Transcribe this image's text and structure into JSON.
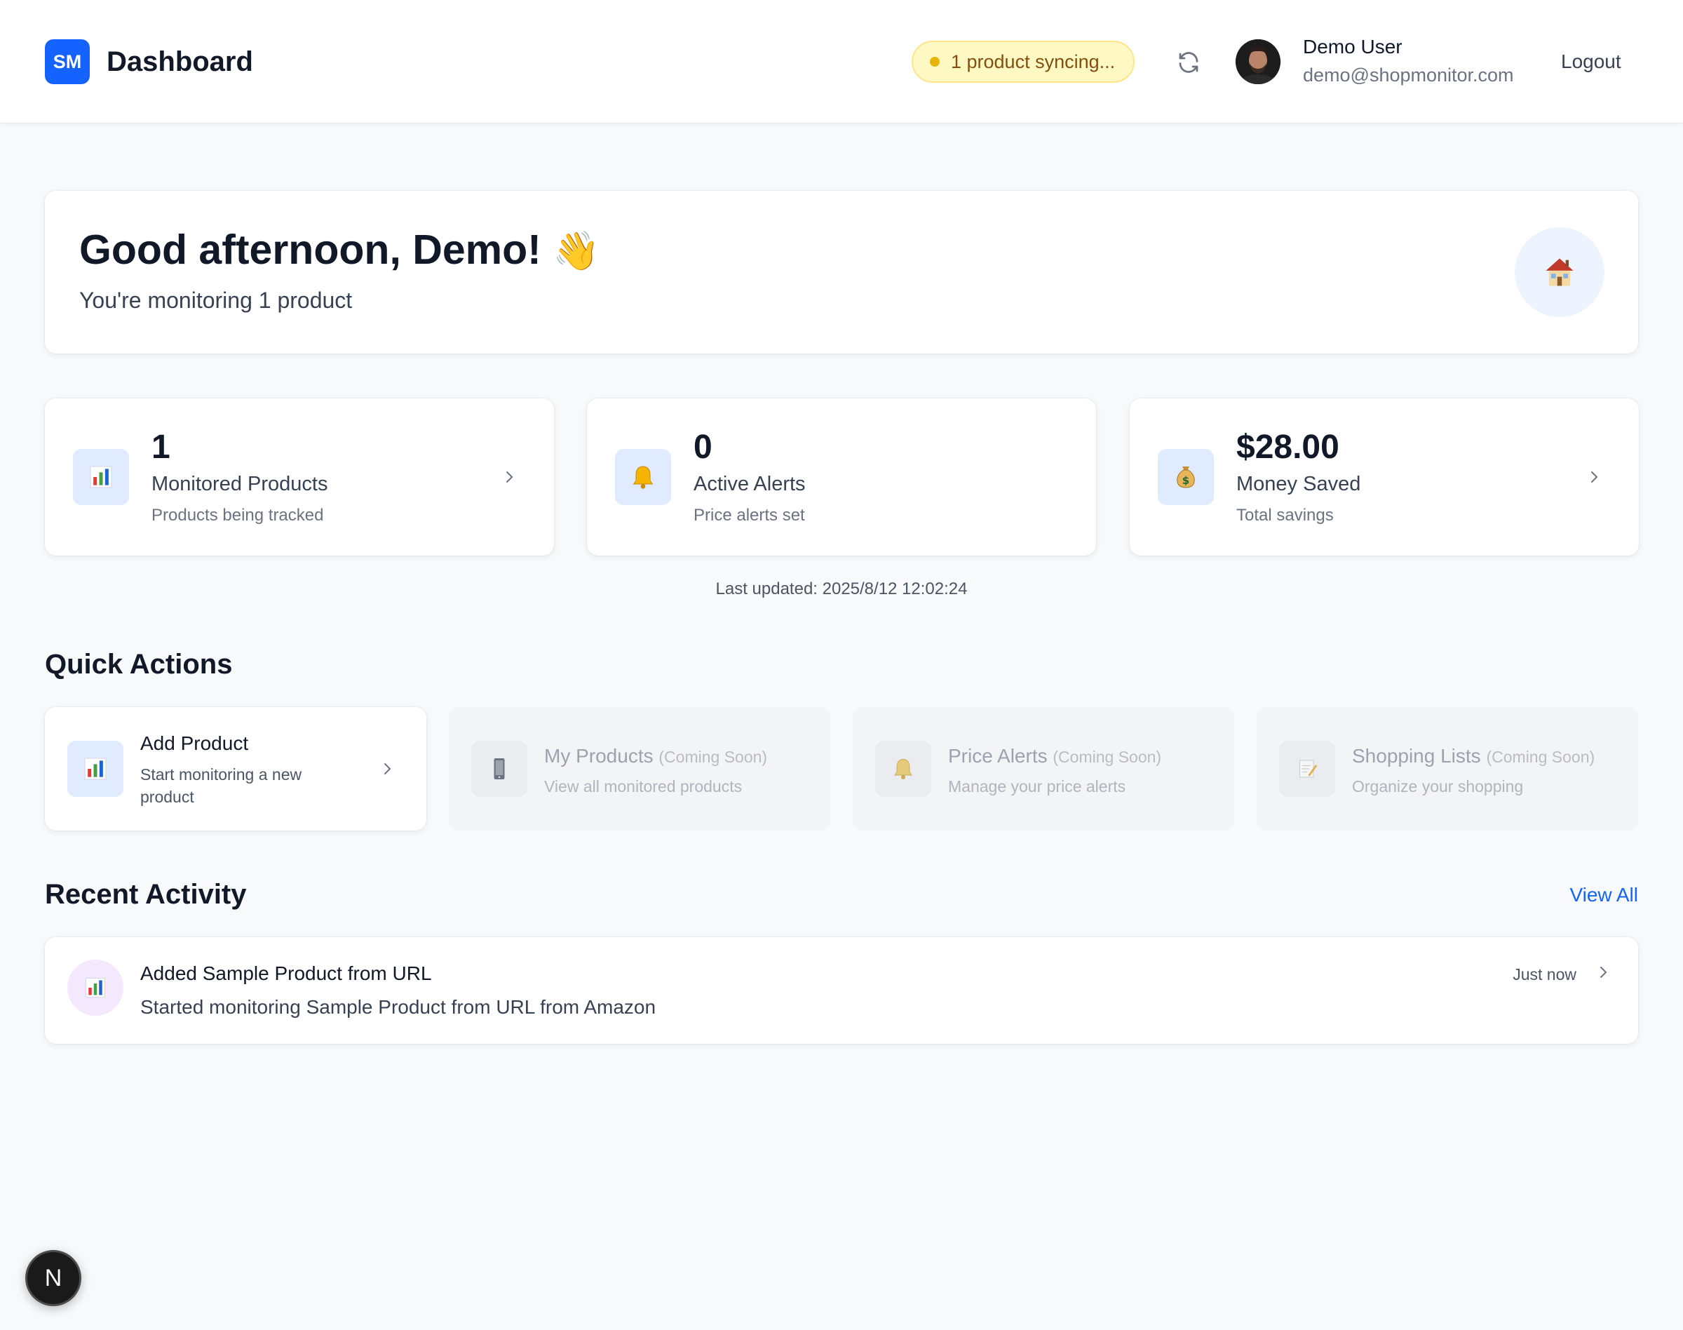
{
  "header": {
    "logo_text": "SM",
    "title": "Dashboard",
    "sync_status": "1 product syncing...",
    "user_name": "Demo User",
    "user_email": "demo@shopmonitor.com",
    "logout_label": "Logout",
    "accent_color": "#1463ff",
    "sync_dot_color": "#eab308"
  },
  "greeting": {
    "title": "Good afternoon, Demo!",
    "subtitle": "You're monitoring 1 product",
    "wave_icon": "waving-hand-icon",
    "home_icon": "house-icon"
  },
  "stats": [
    {
      "value": "1",
      "label": "Monitored Products",
      "description": "Products being tracked",
      "icon": "bar-chart-icon"
    },
    {
      "value": "0",
      "label": "Active Alerts",
      "description": "Price alerts set",
      "icon": "bell-icon"
    },
    {
      "value": "$28.00",
      "label": "Money Saved",
      "description": "Total savings",
      "icon": "money-bag-icon"
    }
  ],
  "last_updated": "Last updated: 2025/8/12 12:02:24",
  "quick_actions": {
    "title": "Quick Actions",
    "items": [
      {
        "label": "Add Product",
        "description": "Start monitoring a new product",
        "icon": "bar-chart-icon"
      },
      {
        "label": "My Products",
        "badge": "(Coming Soon)",
        "description": "View all monitored products",
        "icon": "phone-icon"
      },
      {
        "label": "Price Alerts",
        "badge": "(Coming Soon)",
        "description": "Manage your price alerts",
        "icon": "bell-icon"
      },
      {
        "label": "Shopping Lists",
        "badge": "(Coming Soon)",
        "description": "Organize your shopping",
        "icon": "memo-icon"
      }
    ]
  },
  "recent_activity": {
    "title": "Recent Activity",
    "view_all_label": "View All",
    "items": [
      {
        "title": "Added Sample Product from URL",
        "description": "Started monitoring Sample Product from URL from Amazon",
        "time": "Just now",
        "icon": "bar-chart-icon"
      }
    ]
  },
  "dev_badge": "N"
}
